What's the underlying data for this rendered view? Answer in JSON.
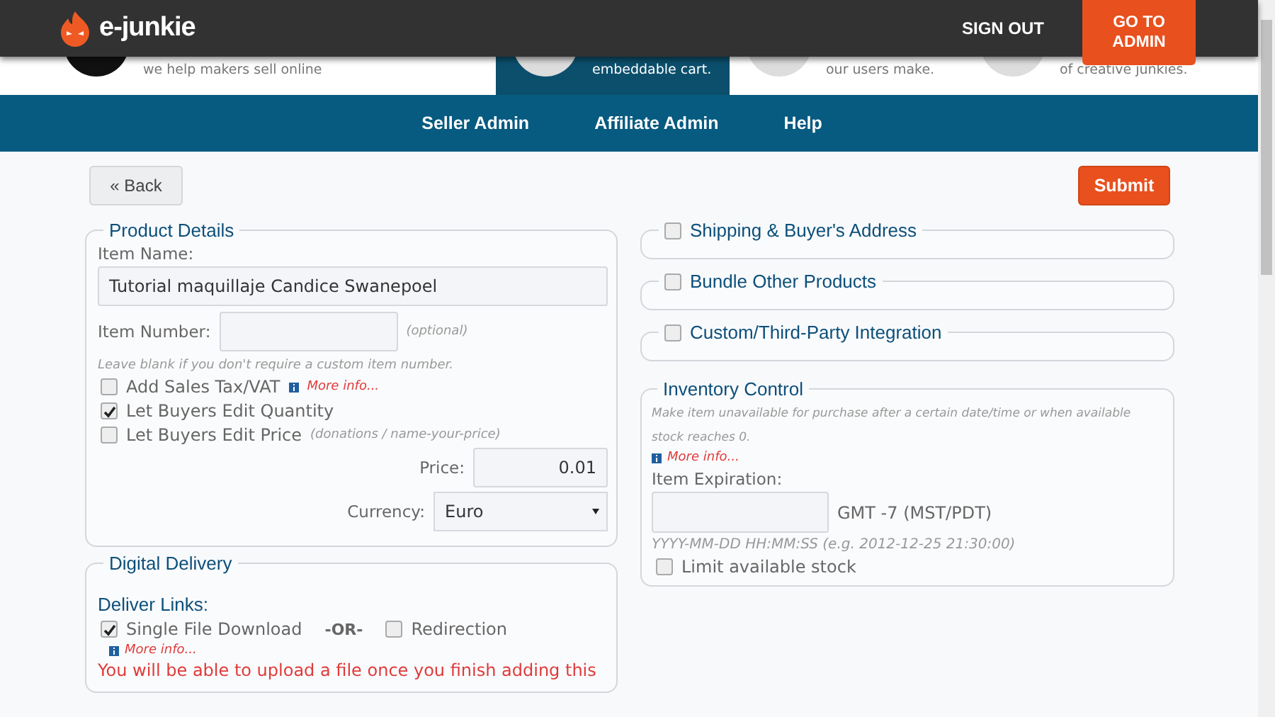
{
  "header": {
    "logo_text": "e-junkie",
    "sign_out": "SIGN OUT",
    "go_to_admin": [
      "GO TO",
      "ADMIN"
    ]
  },
  "promo_strip": [
    {
      "text": "we help makers sell online",
      "selected": false
    },
    {
      "text": "embeddable cart.",
      "selected": true
    },
    {
      "text": "our users make.",
      "selected": false
    },
    {
      "text": "of creative junkies.",
      "selected": false
    }
  ],
  "nav": [
    {
      "label": "Seller Admin"
    },
    {
      "label": "Affiliate Admin"
    },
    {
      "label": "Help"
    }
  ],
  "toolbar": {
    "back": "« Back",
    "submit": "Submit"
  },
  "product_details": {
    "title": "Product Details",
    "item_name_label": "Item Name:",
    "item_name_value": "Tutorial maquillaje Candice Swanepoel",
    "item_number_label": "Item Number:",
    "item_number_hint": "(optional)",
    "item_number_note": "Leave blank if you don't require a custom item number.",
    "options": [
      {
        "label": "Add Sales Tax/VAT",
        "checked": false,
        "more_info": "More info..."
      },
      {
        "label": "Let Buyers Edit Quantity",
        "checked": true
      },
      {
        "label": "Let Buyers Edit Price",
        "checked": false,
        "note": "(donations / name-your-price)"
      }
    ],
    "price_label": "Price:",
    "price_value": "0.01",
    "currency_label": "Currency:",
    "currency_value": "Euro"
  },
  "digital_delivery": {
    "title": "Digital Delivery",
    "deliver_links_label": "Deliver Links:",
    "options": [
      {
        "label": "Single File Download",
        "checked": true
      },
      {
        "label": "Redirection",
        "checked": false
      }
    ],
    "separator": "-OR-",
    "more_info": "More info...",
    "notice": "You will be able to upload a file once you finish adding this"
  },
  "right_sections": [
    {
      "title": "Shipping & Buyer's Address",
      "checked": false
    },
    {
      "title": "Bundle Other Products",
      "checked": false
    },
    {
      "title": "Custom/Third-Party Integration",
      "checked": false
    }
  ],
  "inventory": {
    "title": "Inventory Control",
    "description": "Make item unavailable for purchase after a certain date/time or when available stock reaches 0.",
    "more_info": "More info...",
    "expiration_label": "Item Expiration:",
    "timezone": "GMT -7 (MST/PDT)",
    "format_hint": "YYYY-MM-DD HH:MM:SS (e.g. 2012-12-25 21:30:00)",
    "limit_stock": {
      "label": "Limit available stock",
      "checked": false
    }
  }
}
